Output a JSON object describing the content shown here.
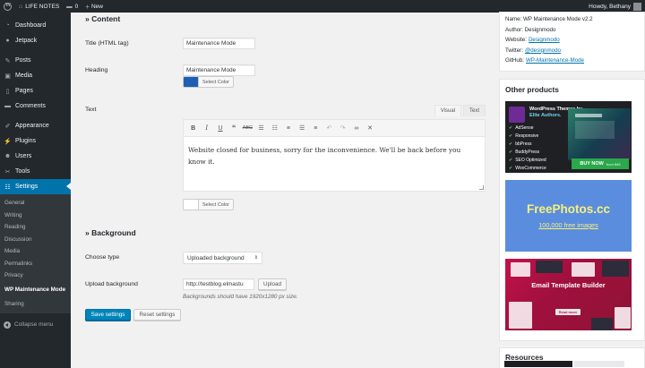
{
  "adminbar": {
    "site_name": "LIFE NOTES",
    "comments_count": "0",
    "new_label": "New",
    "howdy": "Howdy, Bethany"
  },
  "sidebar": {
    "items": [
      {
        "label": "Dashboard",
        "icon": "dashboard-icon"
      },
      {
        "label": "Jetpack",
        "icon": "jetpack-icon"
      },
      {
        "label": "Posts",
        "icon": "pin-icon"
      },
      {
        "label": "Media",
        "icon": "media-icon"
      },
      {
        "label": "Pages",
        "icon": "page-icon"
      },
      {
        "label": "Comments",
        "icon": "comment-icon"
      },
      {
        "label": "Appearance",
        "icon": "brush-icon"
      },
      {
        "label": "Plugins",
        "icon": "plug-icon"
      },
      {
        "label": "Users",
        "icon": "user-icon"
      },
      {
        "label": "Tools",
        "icon": "wrench-icon"
      },
      {
        "label": "Settings",
        "icon": "settings-icon"
      }
    ],
    "submenu": [
      "General",
      "Writing",
      "Reading",
      "Discussion",
      "Media",
      "Permalinks",
      "Privacy",
      "WP Maintenance Mode",
      "Sharing"
    ],
    "collapse_label": "Collapse menu"
  },
  "content": {
    "section_title": "» Content",
    "title_label": "Title (HTML tag)",
    "title_value": "Maintenance Mode",
    "heading_label": "Heading",
    "heading_value": "Maintenance Mode",
    "heading_color": "#1e5fb5",
    "select_color_label": "Select Color",
    "text_label": "Text",
    "tab_visual": "Visual",
    "tab_text": "Text",
    "toolbar_icons": [
      "bold-icon",
      "italic-icon",
      "underline-icon",
      "blockquote-icon",
      "strikethrough-icon",
      "bulleted-list-icon",
      "numbered-list-icon",
      "align-left-icon",
      "align-center-icon",
      "align-right-icon",
      "undo-icon",
      "redo-icon",
      "link-icon",
      "fullscreen-icon"
    ],
    "editor_text": "Website closed for business, sorry for the inconvenience. We'll be back before you know it.",
    "text_color_label": "Select Color"
  },
  "background": {
    "section_title": "» Background",
    "choose_type_label": "Choose type",
    "choose_type_value": "Uploaded background",
    "upload_label": "Upload background",
    "upload_value": "http://testblog.elmastu",
    "upload_button": "Upload",
    "hint": "Backgrounds should have 1920x1280 px size."
  },
  "actions": {
    "save": "Save settings",
    "reset": "Reset settings"
  },
  "plugin_info": {
    "name": "Name: WP Maintenance Mode v2.2",
    "author": "Author: Designmodo",
    "website_prefix": "Website:",
    "website_link": "Designmodo",
    "twitter_prefix": "Twitter:",
    "twitter_link": "@designmodo",
    "github_prefix": "GitHub:",
    "github_link": "WP-Maintenance-Mode"
  },
  "other_products": {
    "title": "Other products",
    "ad1": {
      "heading_a": "WordPress Themes by",
      "heading_b": "Elite Authors.",
      "features": [
        "AdSense",
        "Responsive",
        "bbPress",
        "BuddyPress",
        "SEO Optimized",
        "WooCommerce"
      ],
      "buy": "BUY NOW",
      "buy_small": "from $45"
    },
    "ad2": {
      "title": "FreePhotos.cc",
      "subtitle": "100,000 free images"
    },
    "ad3": {
      "title": "Email Template Builder",
      "button": "Read more"
    }
  },
  "resources": {
    "title": "Resources"
  },
  "colors": {
    "accent": "#0073aa",
    "sidebar": "#23282d",
    "primary_button": "#0085ba"
  }
}
